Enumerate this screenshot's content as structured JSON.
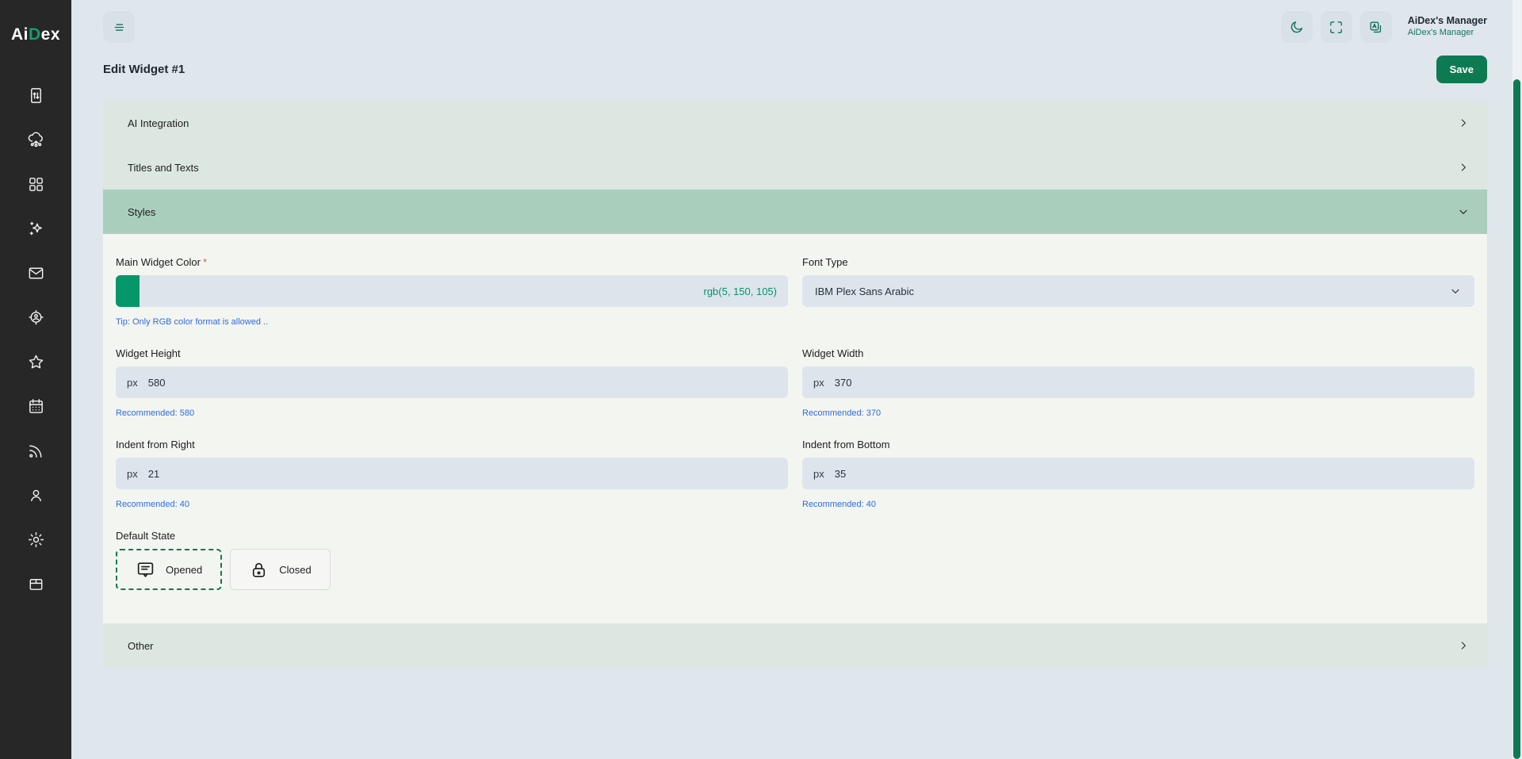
{
  "brand": {
    "prefix": "Ai",
    "accent": "D",
    "suffix": "ex"
  },
  "topbar": {
    "user_name": "AiDex's Manager",
    "user_role": "AiDex's Manager",
    "icons": [
      "menu-icon",
      "moon-icon",
      "fullscreen-icon",
      "translate-icon"
    ]
  },
  "page": {
    "title": "Edit Widget #1",
    "save_label": "Save"
  },
  "accordion": {
    "sections": [
      {
        "label": "AI Integration",
        "state": "collapsed"
      },
      {
        "label": "Titles and Texts",
        "state": "collapsed"
      },
      {
        "label": "Styles",
        "state": "expanded"
      },
      {
        "label": "Other",
        "state": "collapsed"
      }
    ]
  },
  "form": {
    "main_widget_color": {
      "label": "Main Widget Color",
      "required_marker": "*",
      "value": "rgb(5, 150, 105)",
      "swatch_color": "#059669",
      "tip": "Tip: Only RGB color format is allowed .."
    },
    "font_type": {
      "label": "Font Type",
      "value": "IBM Plex Sans Arabic"
    },
    "widget_height": {
      "label": "Widget Height",
      "unit": "px",
      "value": "580",
      "hint": "Recommended: 580"
    },
    "widget_width": {
      "label": "Widget Width",
      "unit": "px",
      "value": "370",
      "hint": "Recommended: 370"
    },
    "indent_right": {
      "label": "Indent from Right",
      "unit": "px",
      "value": "21",
      "hint": "Recommended: 40"
    },
    "indent_bottom": {
      "label": "Indent from Bottom",
      "unit": "px",
      "value": "35",
      "hint": "Recommended: 40"
    },
    "default_state": {
      "label": "Default State",
      "options": [
        {
          "label": "Opened",
          "icon": "message-square-icon",
          "selected": true
        },
        {
          "label": "Closed",
          "icon": "lock-icon",
          "selected": false
        }
      ]
    }
  },
  "sidebar": {
    "items": [
      "document-arrows-icon",
      "cloud-network-icon",
      "apps-grid-icon",
      "sparkles-icon",
      "mail-icon",
      "user-target-icon",
      "star-icon",
      "calendar-icon",
      "rss-icon",
      "user-icon",
      "settings-gear-icon",
      "box-icon"
    ]
  },
  "colors": {
    "accent_green": "#0E7A52",
    "swatch_green": "#059669",
    "value_teal": "#0A9168",
    "hint_blue": "#2F6BDF",
    "expanded_header_green": "#A9CEBC",
    "section_green": "#DBE7E0",
    "panel_bg": "#F3F5F1",
    "input_bg": "#DDE4EC",
    "sidebar_bg": "#272727",
    "page_bg": "#DFE6EC"
  }
}
